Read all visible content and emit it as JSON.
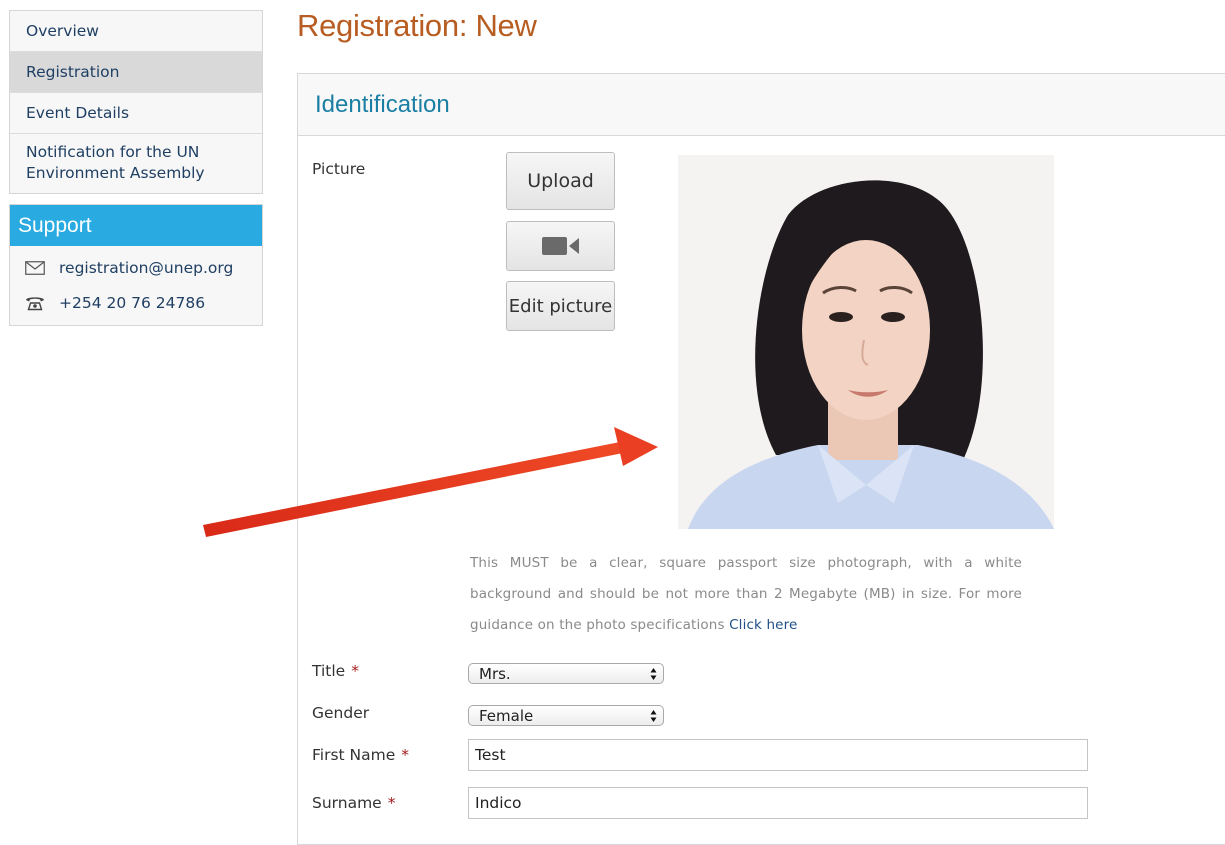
{
  "sidebar": {
    "items": [
      {
        "label": "Overview"
      },
      {
        "label": "Registration",
        "active": true
      },
      {
        "label": "Event Details"
      },
      {
        "label": "Notification for the UN Environment Assembly"
      }
    ]
  },
  "support": {
    "title": "Support",
    "email": "registration@unep.org",
    "phone": "+254 20 76 24786",
    "email_icon": "envelope-icon",
    "phone_icon": "telephone-icon",
    "header_color": "#29abe2"
  },
  "page": {
    "title": "Registration: New",
    "title_color": "#b85d22"
  },
  "identification": {
    "section_title": "Identification",
    "picture_label": "Picture",
    "upload_label": "Upload",
    "camera_icon": "video-camera-icon",
    "edit_label": "Edit picture",
    "helper_text": "This MUST be a clear, square passport size photograph, with a white background and should be not more than 2 Megabyte (MB) in size. For more guidance on the photo specifications",
    "helper_link": "Click here"
  },
  "form": {
    "title_label": "Title",
    "title_value": "Mrs.",
    "gender_label": "Gender",
    "gender_value": "Female",
    "first_name_label": "First Name",
    "first_name_value": "Test",
    "surname_label": "Surname",
    "surname_value": "Indico",
    "required_mark": "*"
  },
  "annotation": {
    "arrow_color": "#e8341c"
  }
}
